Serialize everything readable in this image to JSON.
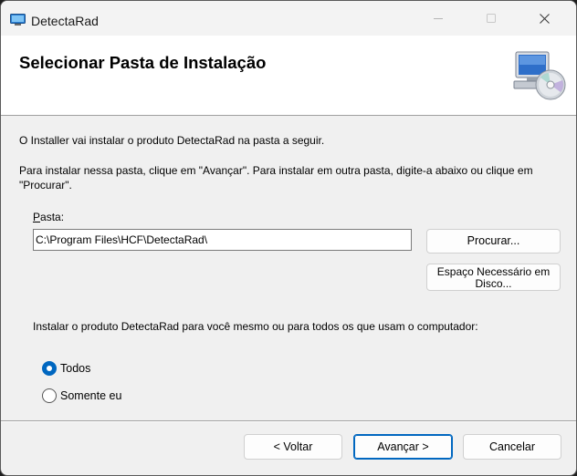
{
  "window": {
    "title": "DetectaRad",
    "app_icon": "installer-icon",
    "controls": {
      "minimize": "minimize-icon",
      "maximize": "maximize-icon",
      "close": "close-icon"
    }
  },
  "header": {
    "title": "Selecionar Pasta de Instalação",
    "icon": "computer-disc-icon"
  },
  "body": {
    "description1": "O Installer vai instalar o produto DetectaRad na pasta a seguir.",
    "description2": "Para instalar nessa pasta, clique em \"Avançar\". Para instalar em outra pasta, digite-a abaixo ou clique em \"Procurar\".",
    "folder_label_access": "P",
    "folder_label_rest": "asta:",
    "folder_path": "C:\\Program Files\\HCF\\DetectaRad\\",
    "browse_label": "Procurar...",
    "disk_space_label": "Espaço Necessário em Disco...",
    "install_for_label": "Instalar o produto DetectaRad para você mesmo ou para todos os que usam o computador:",
    "options": [
      {
        "label": "Todos",
        "selected": true
      },
      {
        "label": "Somente eu",
        "selected": false
      }
    ]
  },
  "footer": {
    "back_label": "< Voltar",
    "next_label": "Avançar >",
    "cancel_label": "Cancelar"
  },
  "colors": {
    "accent": "#0067c0",
    "header_bg": "#ffffff",
    "body_bg": "#f0f0f0"
  }
}
